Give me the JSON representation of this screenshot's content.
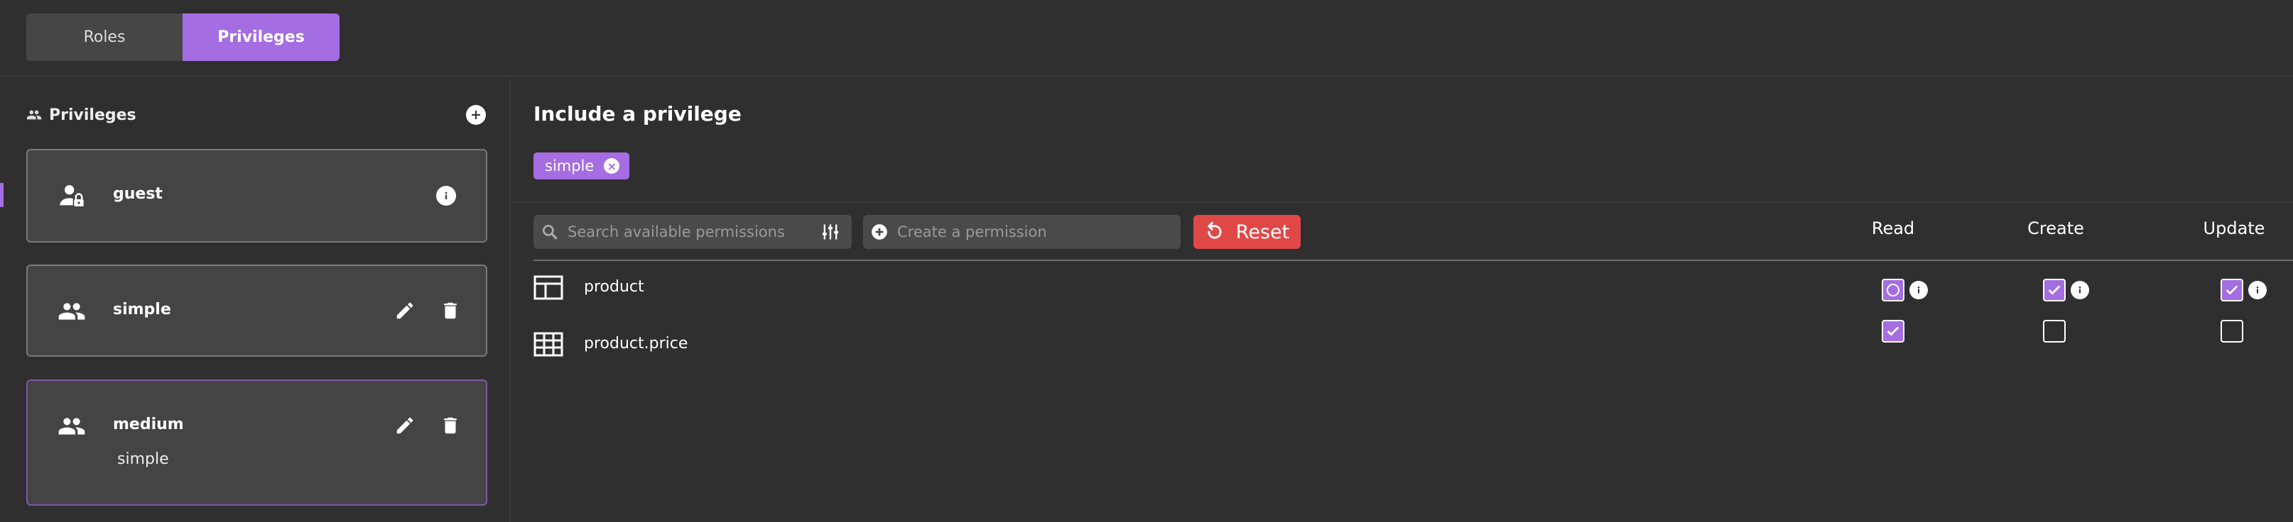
{
  "tabs": [
    {
      "label": "Roles",
      "active": false
    },
    {
      "label": "Privileges",
      "active": true
    }
  ],
  "sidebar": {
    "title": "Privileges",
    "icon": "people-icon",
    "add_icon": "plus-circle-icon",
    "items": [
      {
        "name": "guest",
        "icon": "person-lock-icon",
        "subtitle": "",
        "actions": [
          "info-icon"
        ]
      },
      {
        "name": "simple",
        "icon": "people-icon",
        "subtitle": "",
        "actions": [
          "edit-icon",
          "delete-icon"
        ]
      },
      {
        "name": "medium",
        "icon": "people-icon",
        "subtitle": "simple",
        "actions": [
          "edit-icon",
          "delete-icon"
        ]
      }
    ]
  },
  "main": {
    "title": "Include a privilege",
    "included": [
      {
        "label": "simple",
        "remove_icon": "close-icon"
      }
    ],
    "search": {
      "placeholder": "Search available permissions",
      "icon": "search-icon",
      "filter_icon": "sliders-icon"
    },
    "create": {
      "placeholder": "Create a permission",
      "icon": "plus-circle-icon"
    },
    "reset_label": "Reset",
    "reset_icon": "refresh-icon",
    "columns": [
      "Read",
      "Create",
      "Update"
    ],
    "rows": [
      {
        "label": "product",
        "icon": "table-layout-icon",
        "read": "partial",
        "create": "checked",
        "update": "checked",
        "info": true
      },
      {
        "label": "product.price",
        "icon": "table-grid-icon",
        "read": "checked",
        "create": "empty",
        "update": "empty",
        "info": false
      }
    ]
  },
  "colors": {
    "accent": "#a56de2",
    "danger": "#e04848",
    "background": "#2f2f2f",
    "card": "#444444"
  }
}
